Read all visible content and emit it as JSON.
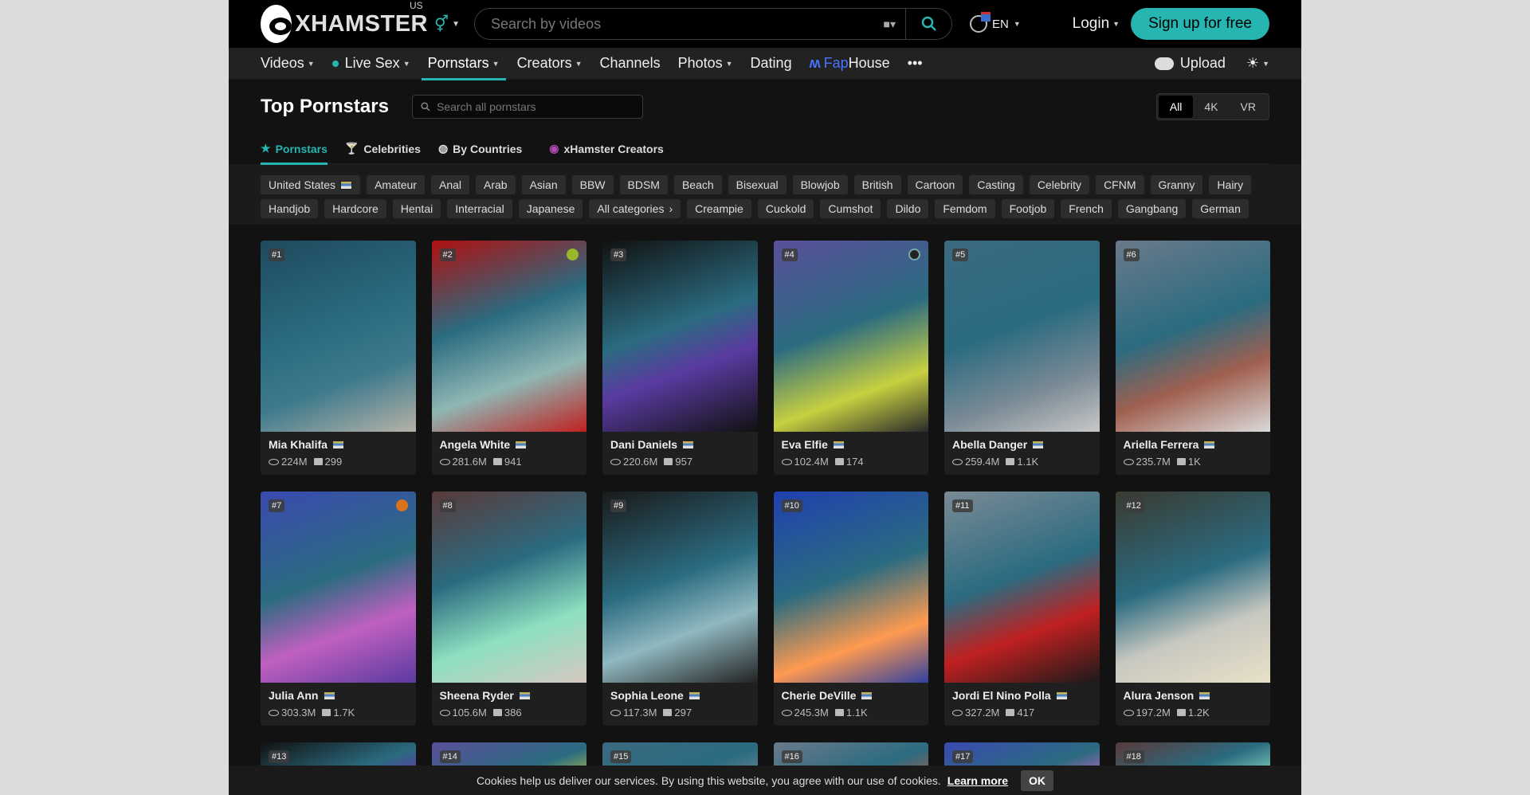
{
  "header": {
    "logo_text": "XHAMSTER",
    "region": "US",
    "search_placeholder": "Search by videos",
    "language": "EN",
    "login": "Login",
    "signup": "Sign up for free"
  },
  "nav": {
    "items": [
      "Videos",
      "Live Sex",
      "Pornstars",
      "Creators",
      "Channels",
      "Photos",
      "Dating"
    ],
    "fap": "Fap",
    "house": "House",
    "more": "•••",
    "upload": "Upload"
  },
  "page": {
    "title": "Top Pornstars",
    "filter_placeholder": "Search all pornstars",
    "quality": [
      "All",
      "4K",
      "VR"
    ],
    "tabs": [
      "Pornstars",
      "Celebrities",
      "By Countries",
      "xHamster Creators"
    ]
  },
  "tags": [
    "United States",
    "Amateur",
    "Anal",
    "Arab",
    "Asian",
    "BBW",
    "BDSM",
    "Beach",
    "Bisexual",
    "Blowjob",
    "British",
    "Cartoon",
    "Casting",
    "Celebrity",
    "CFNM",
    "Granny",
    "Hairy",
    "Handjob",
    "Hardcore",
    "Hentai",
    "Interracial",
    "Japanese",
    "All categories",
    "Creampie",
    "Cuckold",
    "Cumshot",
    "Dildo",
    "Femdom",
    "Footjob",
    "French",
    "Gangbang",
    "German"
  ],
  "cards": [
    {
      "rank": "#1",
      "name": "Mia Khalifa",
      "views": "224M",
      "videos": "299",
      "badge": ""
    },
    {
      "rank": "#2",
      "name": "Angela White",
      "views": "281.6M",
      "videos": "941",
      "badge": "green"
    },
    {
      "rank": "#3",
      "name": "Dani Daniels",
      "views": "220.6M",
      "videos": "957",
      "badge": ""
    },
    {
      "rank": "#4",
      "name": "Eva Elfie",
      "views": "102.4M",
      "videos": "174",
      "badge": "dark"
    },
    {
      "rank": "#5",
      "name": "Abella Danger",
      "views": "259.4M",
      "videos": "1.1K",
      "badge": ""
    },
    {
      "rank": "#6",
      "name": "Ariella Ferrera",
      "views": "235.7M",
      "videos": "1K",
      "badge": ""
    },
    {
      "rank": "#7",
      "name": "Julia Ann",
      "views": "303.3M",
      "videos": "1.7K",
      "badge": "orange"
    },
    {
      "rank": "#8",
      "name": "Sheena Ryder",
      "views": "105.6M",
      "videos": "386",
      "badge": ""
    },
    {
      "rank": "#9",
      "name": "Sophia Leone",
      "views": "117.3M",
      "videos": "297",
      "badge": ""
    },
    {
      "rank": "#10",
      "name": "Cherie DeVille",
      "views": "245.3M",
      "videos": "1.1K",
      "badge": ""
    },
    {
      "rank": "#11",
      "name": "Jordi El Nino Polla",
      "views": "327.2M",
      "videos": "417",
      "badge": ""
    },
    {
      "rank": "#12",
      "name": "Alura Jenson",
      "views": "197.2M",
      "videos": "1.2K",
      "badge": ""
    }
  ],
  "stubs": [
    "#13",
    "#14",
    "#15",
    "#16",
    "#17",
    "#18"
  ],
  "cookie": {
    "text": "Cookies help us deliver our services. By using this website, you agree with our use of cookies.",
    "link": "Learn more",
    "ok": "OK"
  },
  "colors": {
    "accent": "#26b5b0",
    "background": "#121212"
  }
}
